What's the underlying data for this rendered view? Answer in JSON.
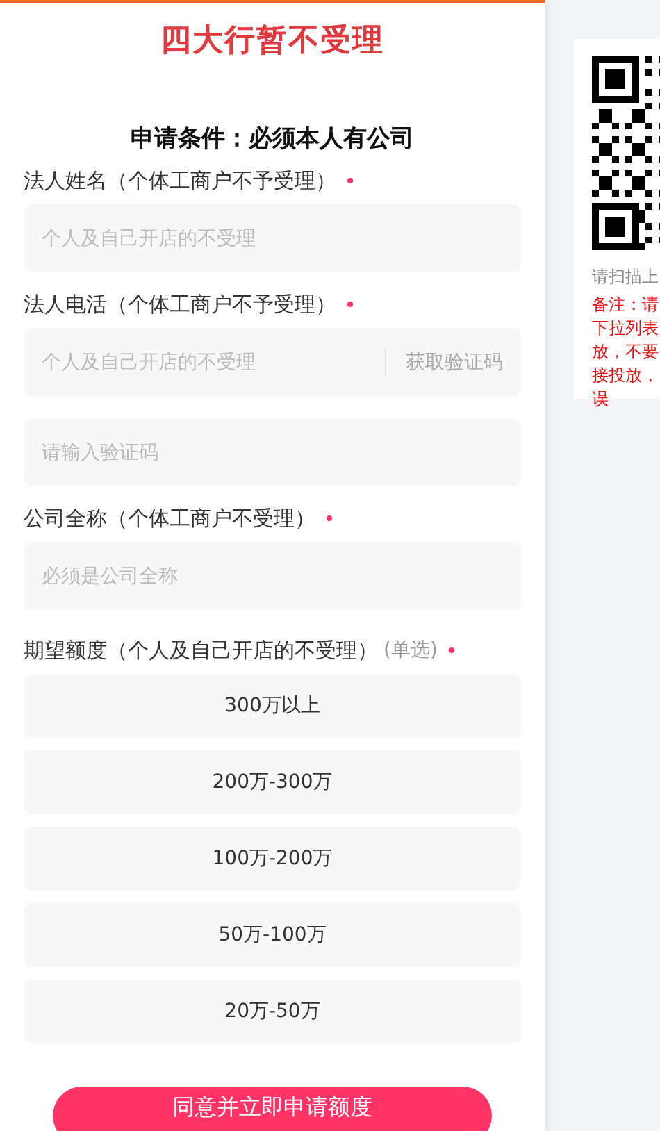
{
  "banner": {
    "title": "四大行暂不受理"
  },
  "form": {
    "heading": "申请条件：必须本人有公司",
    "fields": [
      {
        "kind": "text",
        "label": "法人姓名（个体工商户不予受理）",
        "required": true,
        "placeholder": "个人及自己开店的不受理"
      },
      {
        "kind": "code",
        "label": "法人电活（个体工商户不予受理）",
        "required": true,
        "placeholder": "个人及自己开店的不受理",
        "action": "获取验证码"
      },
      {
        "kind": "plain",
        "placeholder": "请输入验证码"
      },
      {
        "kind": "text",
        "label": "公司全称（个体工商户不受理）",
        "required": true,
        "placeholder": "必须是公司全称"
      }
    ],
    "amount": {
      "label": "期望额度（个人及自己开店的不受理）",
      "hint": "(单选)",
      "required": true,
      "options": [
        {
          "label": "300万以上",
          "selected": false
        },
        {
          "label": "200万-300万",
          "selected": false
        },
        {
          "label": "100万-200万",
          "selected": false
        },
        {
          "label": "50万-100万",
          "selected": false
        },
        {
          "label": "20万-50万",
          "selected": false
        }
      ]
    },
    "submit": "同意并立即申请额度"
  },
  "side_card": {
    "caption": "请扫描上",
    "note_lines": [
      "备注：请",
      "下拉列表",
      "放，不要",
      "接投放，",
      "误"
    ]
  }
}
